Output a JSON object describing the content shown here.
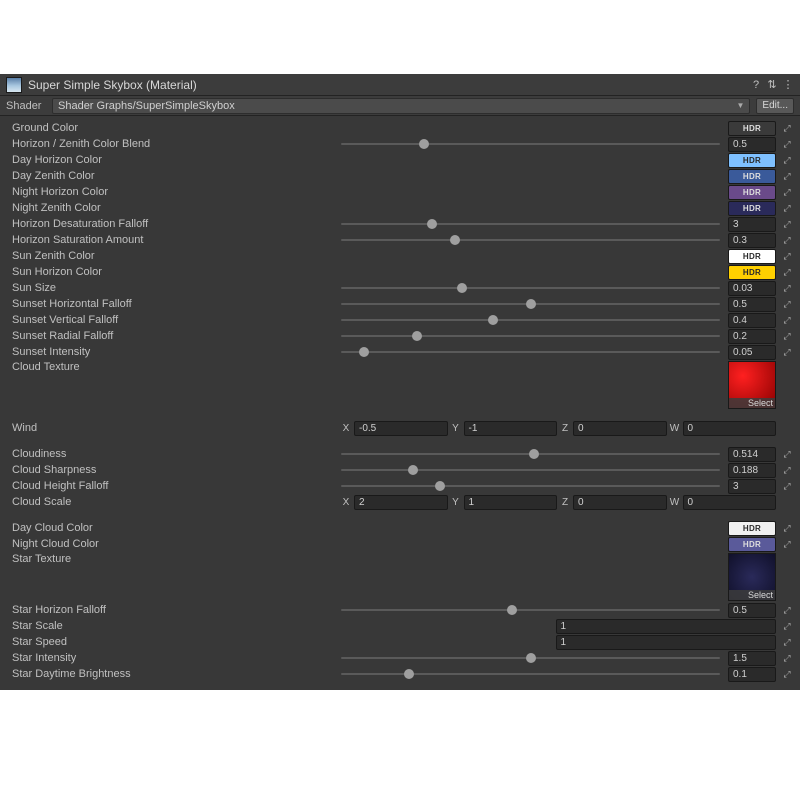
{
  "header": {
    "title": "Super Simple Skybox (Material)"
  },
  "shader": {
    "label": "Shader",
    "value": "Shader Graphs/SuperSimpleSkybox",
    "edit": "Edit..."
  },
  "labels": {
    "ground_color": "Ground Color",
    "horizon_zenith_blend": "Horizon / Zenith Color Blend",
    "day_horizon": "Day Horizon Color",
    "day_zenith": "Day Zenith Color",
    "night_horizon": "Night Horizon Color",
    "night_zenith": "Night Zenith Color",
    "horizon_desat": "Horizon Desaturation Falloff",
    "horizon_sat": "Horizon Saturation Amount",
    "sun_zenith": "Sun Zenith Color",
    "sun_horizon": "Sun Horizon Color",
    "sun_size": "Sun Size",
    "sunset_h": "Sunset Horizontal Falloff",
    "sunset_v": "Sunset Vertical Falloff",
    "sunset_r": "Sunset Radial Falloff",
    "sunset_i": "Sunset Intensity",
    "cloud_tex": "Cloud Texture",
    "wind": "Wind",
    "cloudiness": "Cloudiness",
    "cloud_sharp": "Cloud Sharpness",
    "cloud_height": "Cloud Height Falloff",
    "cloud_scale": "Cloud Scale",
    "day_cloud": "Day Cloud Color",
    "night_cloud": "Night Cloud Color",
    "star_tex": "Star Texture",
    "star_horizon": "Star Horizon Falloff",
    "star_scale": "Star Scale",
    "star_speed": "Star Speed",
    "star_intensity": "Star Intensity",
    "star_daytime": "Star Daytime Brightness"
  },
  "values": {
    "horizon_zenith_blend": "0.5",
    "horizon_desat": "3",
    "horizon_sat": "0.3",
    "sun_size": "0.03",
    "sunset_h": "0.5",
    "sunset_v": "0.4",
    "sunset_r": "0.2",
    "sunset_i": "0.05",
    "cloudiness": "0.514",
    "cloud_sharp": "0.188",
    "cloud_height": "3",
    "star_horizon": "0.5",
    "star_scale": "1",
    "star_speed": "1",
    "star_intensity": "1.5",
    "star_daytime": "0.1",
    "wind_x": "-0.5",
    "wind_y": "-1",
    "wind_z": "0",
    "wind_w": "0",
    "scale_x": "2",
    "scale_y": "1",
    "scale_z": "0",
    "scale_w": "0",
    "select": "Select",
    "hdr": "HDR",
    "x": "X",
    "y": "Y",
    "z": "Z",
    "w": "W"
  },
  "colors": {
    "ground": "#3a3a3a",
    "day_horizon": "#7ec0ff",
    "day_zenith": "#3a5a9a",
    "night_horizon": "#6a4a8a",
    "night_zenith": "#2a2a5a",
    "sun_zenith": "#ffffff",
    "sun_horizon": "#ffd000",
    "day_cloud": "#f0f0f0",
    "night_cloud": "#5a5a9a"
  }
}
